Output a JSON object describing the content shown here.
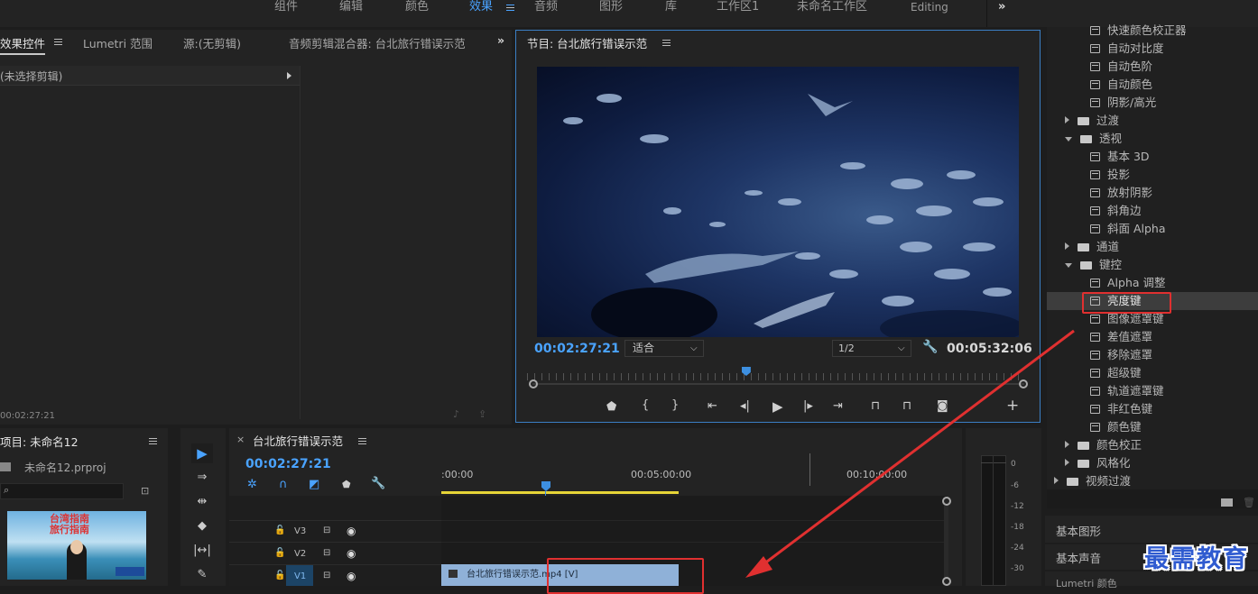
{
  "workspaces": {
    "items": [
      "组件",
      "编辑",
      "颜色",
      "效果",
      "音频",
      "图形",
      "库",
      "工作区1",
      "未命名工作区",
      "Editing"
    ],
    "active": "效果",
    "more": "»"
  },
  "left_panel": {
    "tabs": [
      "效果控件",
      "Lumetri 范围",
      "源:(无剪辑)",
      "音频剪辑混合器: 台北旅行错误示范"
    ],
    "more": "»",
    "no_clip": "(未选择剪辑)",
    "timecode": "00:02:27:21"
  },
  "program": {
    "title": "节目: 台北旅行错误示范",
    "timecode": "00:02:27:21",
    "fit": "适合",
    "resolution": "1/2",
    "duration": "00:05:32:06",
    "playhead_fraction": 0.44
  },
  "effects_tree": {
    "rows": [
      {
        "label": "快速颜色校正器",
        "type": "fx",
        "indent": 2
      },
      {
        "label": "自动对比度",
        "type": "fx",
        "indent": 2
      },
      {
        "label": "自动色阶",
        "type": "fx",
        "indent": 2
      },
      {
        "label": "自动颜色",
        "type": "fx",
        "indent": 2
      },
      {
        "label": "阴影/高光",
        "type": "fx",
        "indent": 2
      },
      {
        "label": "过渡",
        "type": "folder",
        "indent": 1,
        "open": false
      },
      {
        "label": "透视",
        "type": "folder",
        "indent": 1,
        "open": true
      },
      {
        "label": "基本 3D",
        "type": "fx",
        "indent": 2
      },
      {
        "label": "投影",
        "type": "fx",
        "indent": 2
      },
      {
        "label": "放射阴影",
        "type": "fx",
        "indent": 2
      },
      {
        "label": "斜角边",
        "type": "fx",
        "indent": 2
      },
      {
        "label": "斜面 Alpha",
        "type": "fx",
        "indent": 2
      },
      {
        "label": "通道",
        "type": "folder",
        "indent": 1,
        "open": false
      },
      {
        "label": "键控",
        "type": "folder",
        "indent": 1,
        "open": true
      },
      {
        "label": "Alpha 调整",
        "type": "fx",
        "indent": 2
      },
      {
        "label": "亮度键",
        "type": "fx",
        "indent": 2,
        "selected": true
      },
      {
        "label": "图像遮罩键",
        "type": "fx",
        "indent": 2
      },
      {
        "label": "差值遮罩",
        "type": "fx",
        "indent": 2
      },
      {
        "label": "移除遮罩",
        "type": "fx",
        "indent": 2
      },
      {
        "label": "超级键",
        "type": "fx",
        "indent": 2
      },
      {
        "label": "轨道遮罩键",
        "type": "fx",
        "indent": 2
      },
      {
        "label": "非红色键",
        "type": "fx",
        "indent": 2
      },
      {
        "label": "颜色键",
        "type": "fx",
        "indent": 2
      },
      {
        "label": "颜色校正",
        "type": "folder",
        "indent": 1,
        "open": false
      },
      {
        "label": "风格化",
        "type": "folder",
        "indent": 1,
        "open": false
      },
      {
        "label": "视频过渡",
        "type": "folder",
        "indent": 0,
        "open": false
      }
    ],
    "sections": [
      "基本图形",
      "基本声音",
      "Lumetri 颜色"
    ]
  },
  "project": {
    "title": "项目: 未命名12",
    "file": "未命名12.prproj",
    "thumb_text_1": "台湾指南",
    "thumb_text_2": "旅行指南"
  },
  "timeline": {
    "title": "台北旅行错误示范",
    "timecode": "00:02:27:21",
    "ruler": [
      ":00:00",
      "00:05:00:00",
      "00:10:00:00"
    ],
    "tracks": [
      "V3",
      "V2",
      "V1"
    ],
    "clip": "台北旅行错误示范.mp4 [V]"
  },
  "meter": {
    "ticks": [
      "0",
      "-6",
      "-12",
      "-18",
      "-24",
      "-30"
    ]
  },
  "watermark": "最需教育",
  "colors": {
    "accent": "#4aa3ff",
    "highlight": "#e03030",
    "clip": "#8fb1d8"
  }
}
